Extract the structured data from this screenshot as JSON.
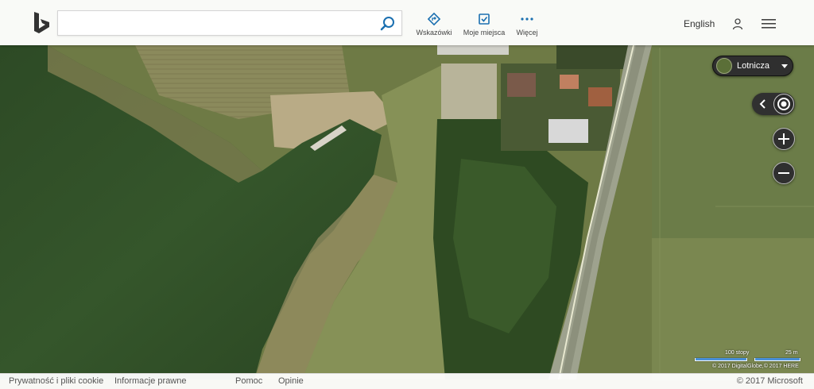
{
  "header": {
    "search_placeholder": "",
    "actions": [
      {
        "id": "directions",
        "label": "Wskazówki",
        "icon": "directions-icon"
      },
      {
        "id": "myplaces",
        "label": "Moje miejsca",
        "icon": "my-places-icon"
      },
      {
        "id": "more",
        "label": "Więcej",
        "icon": "more-icon"
      }
    ],
    "language": "English"
  },
  "map_controls": {
    "map_type_label": "Lotnicza"
  },
  "scale": {
    "imperial_label": "100 stopy",
    "metric_label": "25 m"
  },
  "attribution": "© 2017 DigitalGlobe,© 2017 HERE",
  "footer": {
    "links": [
      "Prywatność i pliki cookie",
      "Informacje prawne",
      "Pomoc",
      "Opinie"
    ],
    "copyright": "© 2017 Microsoft"
  },
  "colors": {
    "accent": "#1a6fb0",
    "header_bg": "#ffffff",
    "control_bg": "#2f2f2f"
  }
}
